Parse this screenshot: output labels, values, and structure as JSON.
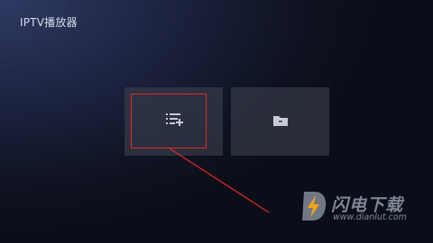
{
  "app": {
    "title": "IPTV播放器"
  },
  "cards": [
    {
      "name": "playlist-add",
      "icon": "playlist-add-icon"
    },
    {
      "name": "folder",
      "icon": "folder-icon"
    }
  ],
  "annotation": {
    "highlight_color": "#e02a2a"
  },
  "watermark": {
    "title": "闪电下载",
    "url": "www.dianlut.com"
  },
  "colors": {
    "background_dark": "#0b0e18",
    "background_glow": "#2f3a63",
    "card": "#3c404e",
    "icon": "#c9ccd6",
    "title_text": "#d7dbe8"
  }
}
